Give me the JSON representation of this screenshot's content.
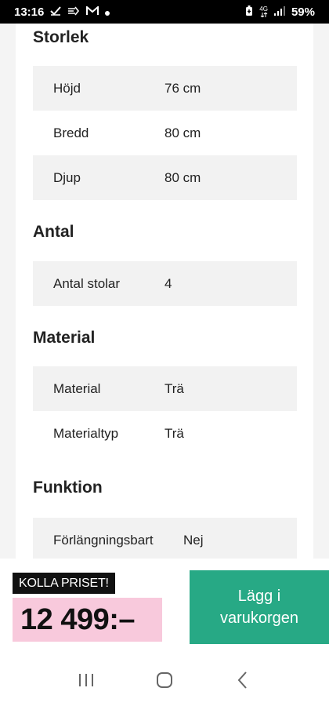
{
  "status_bar": {
    "time": "13:16",
    "battery": "59%",
    "network": "4G",
    "left_icons": [
      "check-icon",
      "transfer-icon",
      "gmail-icon",
      "dot-icon"
    ],
    "right_icons": [
      "battery-saver-icon",
      "network-4g-icon",
      "signal-icon"
    ]
  },
  "sections": {
    "size": {
      "title": "Storlek",
      "rows": [
        {
          "label": "Höjd",
          "value": "76 cm"
        },
        {
          "label": "Bredd",
          "value": "80 cm"
        },
        {
          "label": "Djup",
          "value": "80 cm"
        }
      ]
    },
    "count": {
      "title": "Antal",
      "rows": [
        {
          "label": "Antal stolar",
          "value": "4"
        }
      ]
    },
    "material": {
      "title": "Material",
      "rows": [
        {
          "label": "Material",
          "value": "Trä"
        },
        {
          "label": "Materialtyp",
          "value": "Trä"
        }
      ]
    },
    "function": {
      "title": "Funktion",
      "rows": [
        {
          "label": "Förlängningsbart",
          "value": "Nej"
        }
      ]
    }
  },
  "purchase": {
    "badge": "KOLLA PRISET!",
    "price": "12 499:–",
    "cart_button_line1": "Lägg i",
    "cart_button_line2": "varukorgen",
    "colors": {
      "price_bg": "#f8c9dc",
      "cart_bg": "#27a985",
      "badge_bg": "#111111"
    }
  },
  "nav": {
    "icons": [
      "recent-apps-icon",
      "home-icon",
      "back-icon"
    ]
  }
}
